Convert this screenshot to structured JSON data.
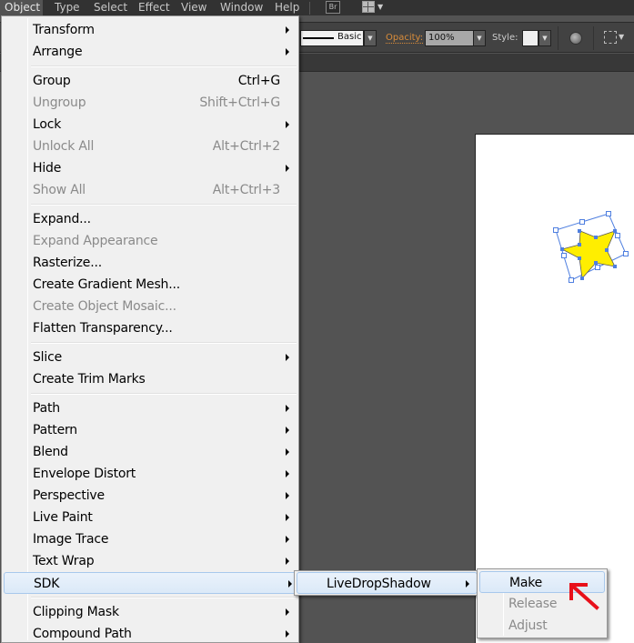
{
  "menubar": {
    "items": [
      "Object",
      "Type",
      "Select",
      "Effect",
      "View",
      "Window",
      "Help"
    ],
    "active": "Object",
    "icons": [
      "bridge-icon",
      "workspace-switcher-icon"
    ],
    "bridge_label": "Br"
  },
  "controlbar": {
    "stroke_profile": "Basic",
    "opacity_label": "Opacity:",
    "opacity_value": "100%",
    "style_label": "Style:",
    "icons": [
      "recolor-artwork-icon",
      "isolate-selection-icon"
    ]
  },
  "object_menu": {
    "groups": [
      [
        {
          "label": "Transform",
          "submenu": true
        },
        {
          "label": "Arrange",
          "submenu": true
        }
      ],
      [
        {
          "label": "Group",
          "shortcut": "Ctrl+G"
        },
        {
          "label": "Ungroup",
          "shortcut": "Shift+Ctrl+G",
          "disabled": true
        },
        {
          "label": "Lock",
          "submenu": true
        },
        {
          "label": "Unlock All",
          "shortcut": "Alt+Ctrl+2",
          "disabled": true
        },
        {
          "label": "Hide",
          "submenu": true
        },
        {
          "label": "Show All",
          "shortcut": "Alt+Ctrl+3",
          "disabled": true
        }
      ],
      [
        {
          "label": "Expand..."
        },
        {
          "label": "Expand Appearance",
          "disabled": true
        },
        {
          "label": "Rasterize..."
        },
        {
          "label": "Create Gradient Mesh..."
        },
        {
          "label": "Create Object Mosaic...",
          "disabled": true
        },
        {
          "label": "Flatten Transparency..."
        }
      ],
      [
        {
          "label": "Slice",
          "submenu": true
        },
        {
          "label": "Create Trim Marks"
        }
      ],
      [
        {
          "label": "Path",
          "submenu": true
        },
        {
          "label": "Pattern",
          "submenu": true
        },
        {
          "label": "Blend",
          "submenu": true
        },
        {
          "label": "Envelope Distort",
          "submenu": true
        },
        {
          "label": "Perspective",
          "submenu": true
        },
        {
          "label": "Live Paint",
          "submenu": true
        },
        {
          "label": "Image Trace",
          "submenu": true
        },
        {
          "label": "Text Wrap",
          "submenu": true
        },
        {
          "label": "SDK",
          "submenu": true,
          "highlighted": true
        }
      ],
      [
        {
          "label": "Clipping Mask",
          "submenu": true
        },
        {
          "label": "Compound Path",
          "submenu": true
        }
      ]
    ]
  },
  "sdk_submenu": {
    "items": [
      {
        "label": "LiveDropShadow",
        "submenu": true,
        "highlighted": true
      }
    ]
  },
  "livedropshadow_submenu": {
    "items": [
      {
        "label": "Make",
        "highlighted": true
      },
      {
        "label": "Release",
        "disabled": true
      },
      {
        "label": "Adjust",
        "disabled": true
      }
    ]
  },
  "canvas": {
    "selected_object": "star",
    "star_fill": "#ffee00",
    "selection_color": "#4f7fe0",
    "annotation_arrow_color": "#e8101a"
  }
}
